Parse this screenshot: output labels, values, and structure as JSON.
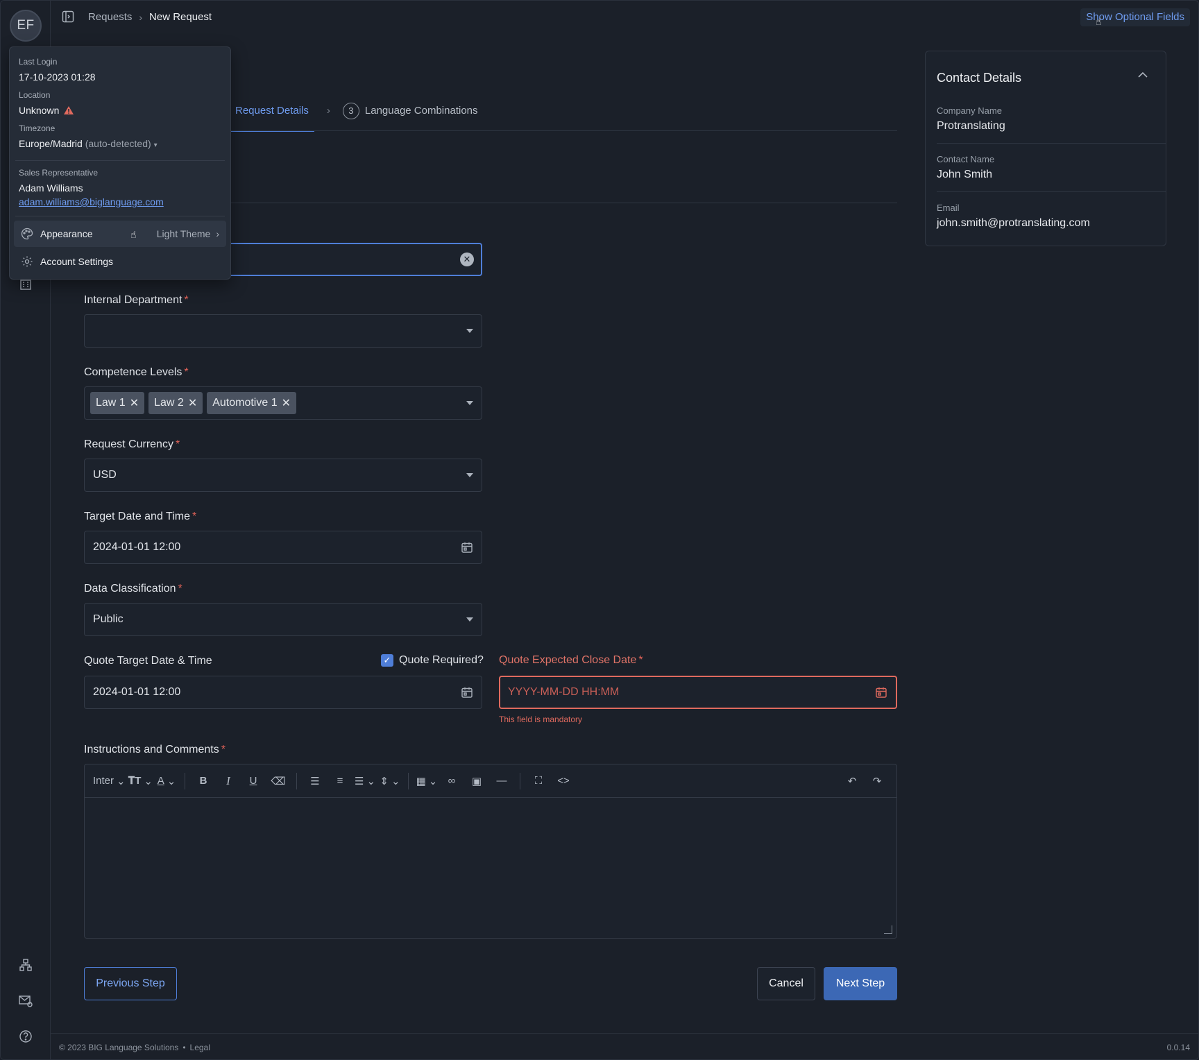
{
  "breadcrumb": {
    "parent": "Requests",
    "current": "New Request"
  },
  "header": {
    "optional_fields_label": "Show Optional Fields"
  },
  "avatar": {
    "initials": "EF"
  },
  "stepper": {
    "active_label": "Request Details",
    "next_number": "3",
    "next_label": "Language Combinations"
  },
  "form": {
    "internal_department": {
      "label": "Internal Department",
      "value": ""
    },
    "competence_levels": {
      "label": "Competence Levels",
      "tags": [
        "Law 1",
        "Law 2",
        "Automotive 1"
      ]
    },
    "request_currency": {
      "label": "Request Currency",
      "value": "USD"
    },
    "target_date": {
      "label": "Target Date and Time",
      "value": "2024-01-01 12:00"
    },
    "data_classification": {
      "label": "Data Classification",
      "value": "Public"
    },
    "quote_target": {
      "label": "Quote Target Date & Time",
      "value": "2024-01-01 12:00"
    },
    "quote_required": {
      "label": "Quote Required?",
      "checked": true
    },
    "quote_close": {
      "label": "Quote Expected Close Date",
      "placeholder": "YYYY-MM-DD HH:MM",
      "error": "This field is mandatory"
    },
    "instructions": {
      "label": "Instructions and Comments",
      "font": "Inter"
    },
    "required_marker": "*"
  },
  "buttons": {
    "previous": "Previous Step",
    "cancel": "Cancel",
    "next": "Next Step"
  },
  "contact": {
    "title": "Contact Details",
    "company_label": "Company Name",
    "company": "Protranslating",
    "contact_label": "Contact Name",
    "contact": "John Smith",
    "email_label": "Email",
    "email": "john.smith@protranslating.com"
  },
  "popover": {
    "last_login_label": "Last Login",
    "last_login": "17-10-2023 01:28",
    "location_label": "Location",
    "location": "Unknown",
    "timezone_label": "Timezone",
    "timezone": "Europe/Madrid",
    "timezone_note": "(auto-detected)",
    "sales_rep_label": "Sales Representative",
    "sales_rep": "Adam Williams",
    "sales_rep_email": "adam.williams@biglanguage.com",
    "appearance_label": "Appearance",
    "appearance_value": "Light Theme",
    "account_settings": "Account Settings"
  },
  "footer": {
    "copyright": "© 2023 BIG Language Solutions",
    "separator": "•",
    "legal": "Legal",
    "version": "0.0.14"
  },
  "colors": {
    "accent": "#4f7ed8",
    "error": "#e06a5e",
    "background": "#1b2029"
  }
}
